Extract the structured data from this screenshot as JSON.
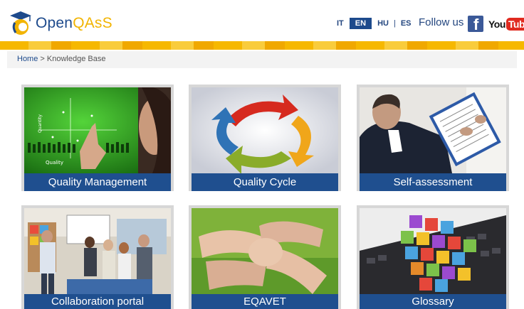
{
  "header": {
    "logo_part1": "Open",
    "logo_part2": "QAsS",
    "languages": [
      {
        "code": "IT",
        "active": false
      },
      {
        "code": "EN",
        "active": true
      },
      {
        "code": "HU",
        "active": false
      },
      {
        "code": "ES",
        "active": false
      }
    ],
    "follow_label": "Follow us",
    "facebook_glyph": "f",
    "youtube_you": "You",
    "youtube_tube": "Tube"
  },
  "breadcrumb": {
    "home": "Home",
    "separator": " > ",
    "current": "Knowledge Base"
  },
  "tiles": [
    {
      "label": "Quality Management",
      "image": "quality-management-image"
    },
    {
      "label": "Quality Cycle",
      "image": "quality-cycle-image"
    },
    {
      "label": "Self-assessment",
      "image": "self-assessment-image"
    },
    {
      "label": "Collaboration portal",
      "image": "collaboration-image"
    },
    {
      "label": "EQAVET",
      "image": "eqavet-image"
    },
    {
      "label": "Glossary",
      "image": "glossary-image"
    }
  ],
  "colors": {
    "brand_blue": "#1d4a8c",
    "brand_yellow": "#f6b800",
    "caption_bg": "#1f4f8f"
  }
}
